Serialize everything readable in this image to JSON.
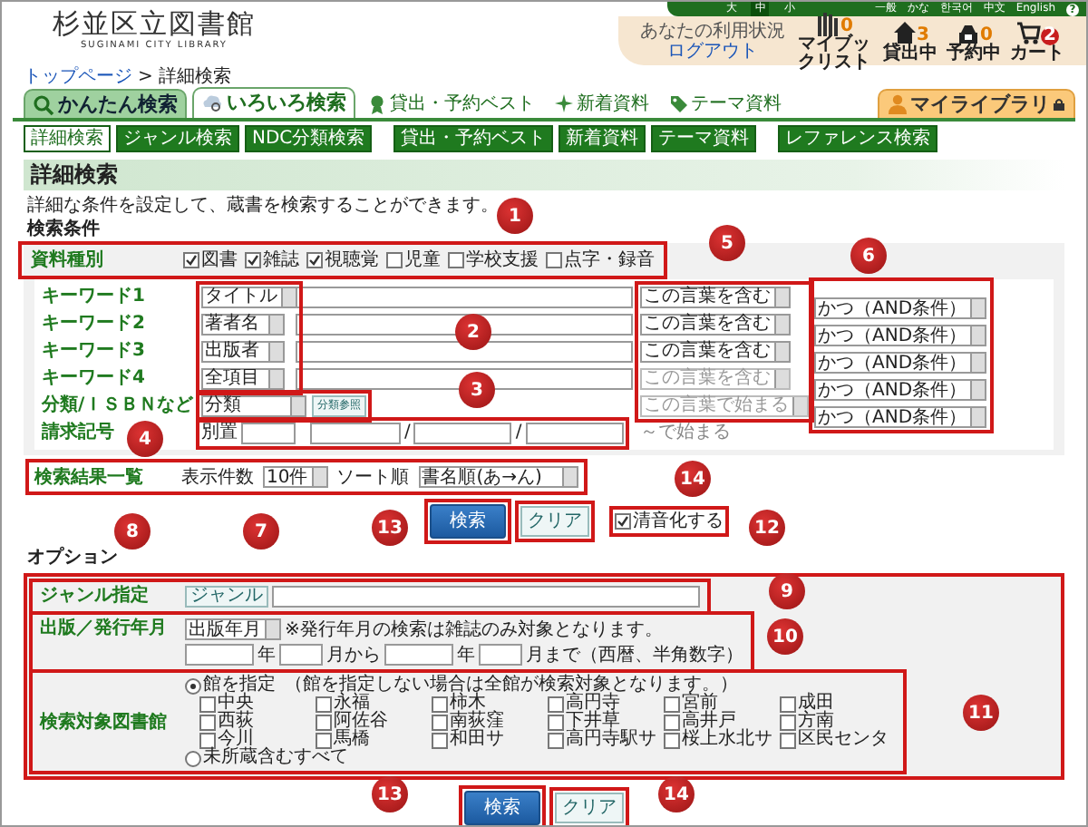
{
  "header": {
    "logo_title": "杉並区立図書館",
    "logo_subtitle": "SUGINAMI CITY LIBRARY",
    "font_sizes": [
      {
        "label": "大",
        "selected": false
      },
      {
        "label": "中",
        "selected": true
      },
      {
        "label": "小",
        "selected": false
      }
    ],
    "languages": [
      "一般",
      "かな",
      "한국어",
      "中文",
      "English"
    ],
    "help": "?",
    "status_label": "あなたの利用状況",
    "logout": "ログアウト",
    "counters": [
      {
        "kind": "booklist",
        "label": "マイブックリスト",
        "count": "0"
      },
      {
        "kind": "loans",
        "label": "貸出中",
        "count": "3"
      },
      {
        "kind": "holds",
        "label": "予約中",
        "count": "0"
      },
      {
        "kind": "cart",
        "label": "カート",
        "count": "2"
      }
    ]
  },
  "breadcrumb": {
    "items": [
      "トップページ",
      "詳細検索"
    ],
    "separator": ">"
  },
  "tabs": [
    {
      "label": "かんたん検索",
      "kind": "search",
      "selected": false
    },
    {
      "label": "いろいろ検索",
      "kind": "cloud",
      "selected": true
    }
  ],
  "quick_links": [
    {
      "label": "貸出・予約ベスト",
      "kind": "medal"
    },
    {
      "label": "新着資料",
      "kind": "sparkle"
    },
    {
      "label": "テーマ資料",
      "kind": "tag"
    }
  ],
  "my_library": "マイライブラリ",
  "sub_tabs": [
    {
      "label": "詳細検索",
      "selected": true
    },
    {
      "label": "ジャンル検索",
      "selected": false
    },
    {
      "label": "NDC分類検索",
      "selected": false
    },
    {
      "label": "貸出・予約ベスト",
      "selected": false
    },
    {
      "label": "新着資料",
      "selected": false
    },
    {
      "label": "テーマ資料",
      "selected": false
    },
    {
      "label": "レファレンス検索",
      "selected": false
    }
  ],
  "page_title": "詳細検索",
  "description": "詳細な条件を設定して、蔵書を検索することができます。",
  "conditions": {
    "heading": "検索条件",
    "material_label": "資料種別",
    "material_types": [
      {
        "label": "図書",
        "checked": true
      },
      {
        "label": "雑誌",
        "checked": true
      },
      {
        "label": "視聴覚",
        "checked": true
      },
      {
        "label": "児童",
        "checked": false
      },
      {
        "label": "学校支援",
        "checked": false
      },
      {
        "label": "点字・録音",
        "checked": false
      }
    ],
    "keywords": [
      {
        "label": "キーワード1",
        "field": "タイトル",
        "match": "この言葉を含む",
        "match_disabled": false
      },
      {
        "label": "キーワード2",
        "field": "著者名",
        "match": "この言葉を含む",
        "match_disabled": false
      },
      {
        "label": "キーワード3",
        "field": "出版者",
        "match": "この言葉を含む",
        "match_disabled": false
      },
      {
        "label": "キーワード4",
        "field": "全項目",
        "match": "この言葉を含む",
        "match_disabled": true
      }
    ],
    "classification": {
      "label": "分類/ＩＳＢＮなど",
      "field": "分類",
      "button": "分類参照",
      "match": "この言葉で始まる",
      "match_disabled": true
    },
    "operators": [
      "かつ（AND条件）",
      "かつ（AND条件）",
      "かつ（AND条件）",
      "かつ（AND条件）",
      "かつ（AND条件）"
    ],
    "call_number": {
      "label": "請求記号",
      "prefix": "別置",
      "separators": [
        "/",
        "/"
      ],
      "suffix": "～で始まる"
    }
  },
  "results": {
    "label": "検索結果一覧",
    "count_label": "表示件数",
    "count": "10件",
    "sort_label": "ソート順",
    "sort": "書名順(あ→ん)"
  },
  "actions": {
    "search": "検索",
    "clear": "クリア",
    "normalize": {
      "label": "清音化する",
      "checked": true
    }
  },
  "options": {
    "heading": "オプション",
    "genre": {
      "label": "ジャンル指定",
      "button": "ジャンル"
    },
    "date": {
      "label": "出版／発行年月",
      "field": "出版年月",
      "note": "※発行年月の検索は雑誌のみ対象となります。",
      "units": [
        "年",
        "月から",
        "年",
        "月まで（西暦、半角数字）"
      ]
    },
    "libraries": {
      "label": "検索対象図書館",
      "modes": [
        {
          "label": "館を指定",
          "note": "（館を指定しない場合は全館が検索対象となります。）",
          "selected": true
        },
        {
          "label": "未所蔵含むすべて",
          "selected": false
        }
      ],
      "branches": [
        {
          "label": "中央",
          "checked": false
        },
        {
          "label": "永福",
          "checked": false
        },
        {
          "label": "柿木",
          "checked": false
        },
        {
          "label": "高円寺",
          "checked": false
        },
        {
          "label": "宮前",
          "checked": false
        },
        {
          "label": "成田",
          "checked": false
        },
        {
          "label": "西荻",
          "checked": false
        },
        {
          "label": "阿佐谷",
          "checked": false
        },
        {
          "label": "南荻窪",
          "checked": false
        },
        {
          "label": "下井草",
          "checked": false
        },
        {
          "label": "高井戸",
          "checked": false
        },
        {
          "label": "方南",
          "checked": false
        },
        {
          "label": "今川",
          "checked": false
        },
        {
          "label": "馬橋",
          "checked": false
        },
        {
          "label": "和田サ",
          "checked": false
        },
        {
          "label": "高円寺駅サ",
          "checked": false
        },
        {
          "label": "桜上水北サ",
          "checked": false
        },
        {
          "label": "区民センタ",
          "checked": false
        }
      ]
    }
  },
  "bottom_actions": {
    "search": "検索",
    "clear": "クリア"
  },
  "callouts": [
    {
      "number": "1"
    },
    {
      "number": "5"
    },
    {
      "number": "6"
    },
    {
      "number": "2"
    },
    {
      "number": "3"
    },
    {
      "number": "4"
    },
    {
      "number": "14"
    },
    {
      "number": "8"
    },
    {
      "number": "7"
    },
    {
      "number": "13"
    },
    {
      "number": "12"
    },
    {
      "number": "9"
    },
    {
      "number": "10"
    },
    {
      "number": "11"
    },
    {
      "number": "13"
    },
    {
      "number": "14"
    }
  ]
}
